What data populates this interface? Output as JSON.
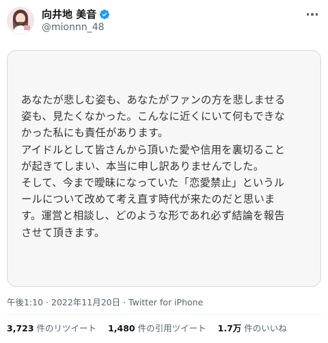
{
  "author": {
    "display_name": "向井地 美音",
    "handle": "@mionnn_48",
    "verified": true,
    "icon": "verified-badge-icon"
  },
  "colors": {
    "verified": "#1d9bf0",
    "secondary_text": "#536471",
    "primary_text": "#0f1419"
  },
  "media": {
    "lines": [
      "あなたが悲しむ姿も、あなたがファンの方を悲しませる",
      "姿も、見たくなかった。こんなに近くにいて何もできな",
      "かった私にも責任があります。",
      "アイドルとして皆さんから頂いた愛や信用を裏切ること",
      "が起きてしまい、本当に申し訳ありませんでした。",
      "そして、今まで曖昧になっていた「恋愛禁止」というル",
      "ールについて改めて考え直す時代が来たのだと思いま",
      "す。運営と相談し、どのような形であれ必ず結論を報告",
      "させて頂きます。"
    ]
  },
  "meta": {
    "text": "午後1:10 · 2022年11月20日 · Twitter for iPhone"
  },
  "stats": [
    {
      "count": "3,723",
      "label": "件のリツイート"
    },
    {
      "count": "1,480",
      "label": "件の引用ツイート"
    },
    {
      "count": "1.7万",
      "label": "件のいいね"
    }
  ]
}
